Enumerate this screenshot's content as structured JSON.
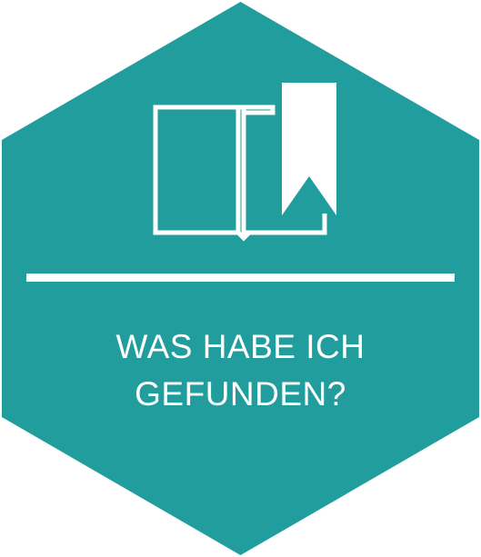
{
  "tile": {
    "background_color": "#219d9e",
    "foreground_color": "#ffffff",
    "icon": "open-book-bookmark-icon",
    "title_line_1": "WAS HABE ICH",
    "title_line_2": "GEFUNDEN?"
  }
}
